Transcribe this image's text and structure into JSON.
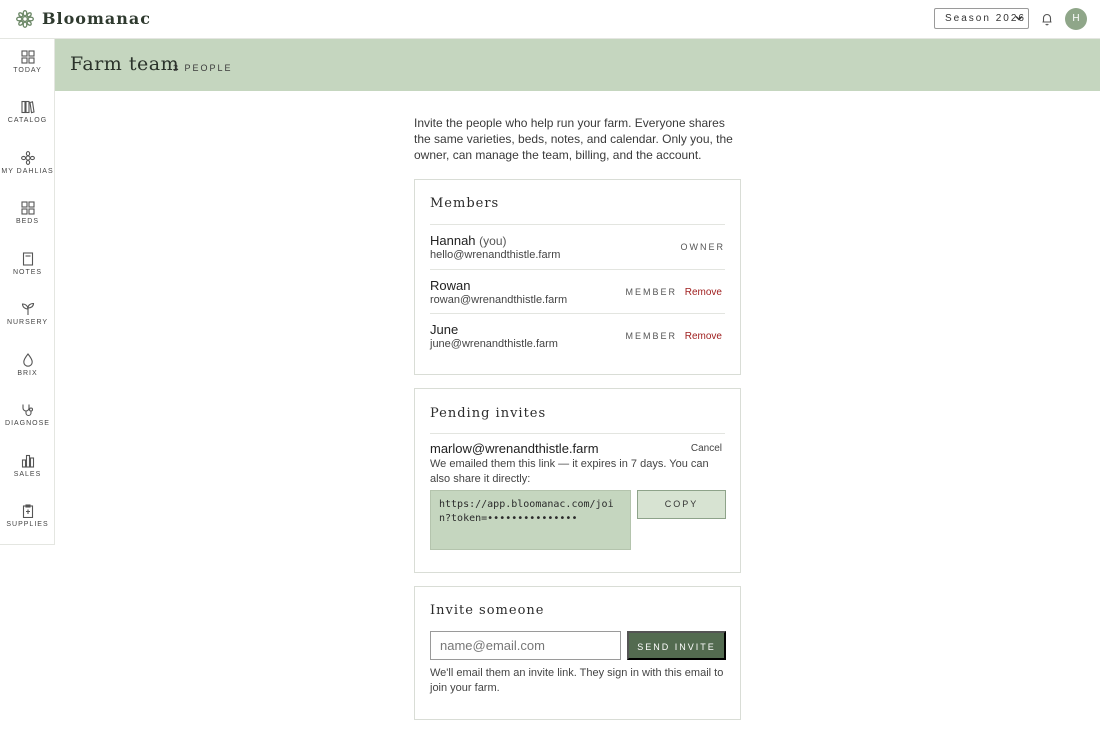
{
  "app": {
    "brand": "Bloomanac",
    "season": "Season 2026",
    "avatar_initial": "H",
    "accent": "#c5d6bf",
    "primary_button": "#536b50",
    "danger": "#a02020"
  },
  "sidebar": {
    "items": [
      {
        "label": "TODAY",
        "icon": "grid-icon"
      },
      {
        "label": "CATALOG",
        "icon": "books-icon"
      },
      {
        "label": "MY DAHLIAS",
        "icon": "flower-icon"
      },
      {
        "label": "BEDS",
        "icon": "beds-grid-icon"
      },
      {
        "label": "NOTES",
        "icon": "notes-icon"
      },
      {
        "label": "NURSERY",
        "icon": "sprout-icon"
      },
      {
        "label": "BRIX",
        "icon": "drop-icon"
      },
      {
        "label": "DIAGNOSE",
        "icon": "stethoscope-icon"
      },
      {
        "label": "SALES",
        "icon": "bar-chart-icon"
      },
      {
        "label": "SUPPLIES",
        "icon": "clipboard-icon"
      }
    ]
  },
  "header": {
    "title": "Farm team",
    "count": "3 PEOPLE"
  },
  "intro": "Invite the people who help run your farm. Everyone shares the same varieties, beds, notes, and calendar. Only you, the owner, can manage the team, billing, and the account.",
  "members": {
    "title": "Members",
    "rows": [
      {
        "name": "Hannah",
        "you": "(you)",
        "email": "hello@wrenandthistle.farm",
        "role": "OWNER"
      },
      {
        "name": "Rowan",
        "email": "rowan@wrenandthistle.farm",
        "role": "MEMBER",
        "action": "Remove"
      },
      {
        "name": "June",
        "email": "june@wrenandthistle.farm",
        "role": "MEMBER",
        "action": "Remove"
      }
    ]
  },
  "pending": {
    "title": "Pending invites",
    "email": "marlow@wrenandthistle.farm",
    "cancel": "Cancel",
    "note": "We emailed them this link — it expires in 7 days. You can also share it directly:",
    "link": "https://app.bloomanac.com/join?token=•••••••••••••••",
    "copy": "COPY"
  },
  "invite": {
    "title": "Invite someone",
    "placeholder": "name@email.com",
    "button": "SEND INVITE",
    "note": "We'll email them an invite link. They sign in with this email to join your farm."
  }
}
